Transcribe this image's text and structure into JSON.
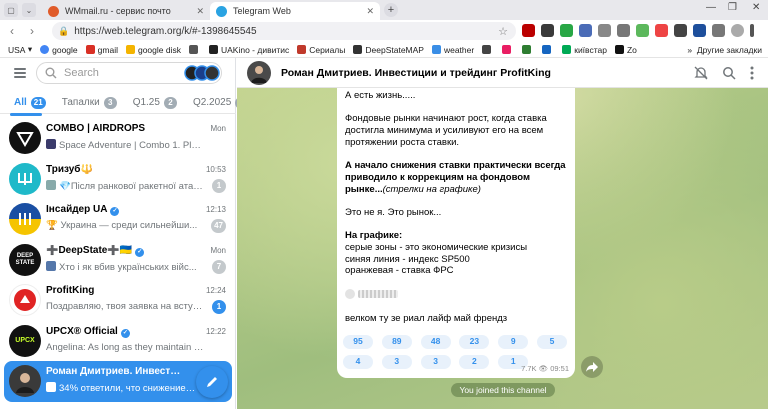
{
  "browser": {
    "tabs": [
      {
        "title": "WMmail.ru - сервис почто",
        "active": false
      },
      {
        "title": "Telegram Web",
        "active": true
      }
    ],
    "url": "https://web.telegram.org/k/#-1398645545",
    "bookmarks_left_label": "USA",
    "bookmarks": [
      "google",
      "gmail",
      "google disk",
      "",
      "UAKino - дивитис",
      "Сериалы",
      "DeepStateMAP",
      "weather",
      "",
      "",
      "",
      "",
      "київстар",
      "Zo"
    ],
    "other_bookmarks": "Другие закладки"
  },
  "sidebar": {
    "search_placeholder": "Search",
    "folders": [
      {
        "label": "All",
        "count": "21",
        "active": true
      },
      {
        "label": "Тапалки",
        "count": "3",
        "active": false
      },
      {
        "label": "Q1.25",
        "count": "2",
        "active": false
      },
      {
        "label": "Q2.2025",
        "count": "1",
        "active": false
      }
    ],
    "chats": [
      {
        "name": "COMBO | AIRDROPS",
        "time": "Mon",
        "preview": "Space Adventure | Combo 1. Pla...",
        "badge": "",
        "avatar_color": "#111111",
        "avatar_text": "",
        "verified": false
      },
      {
        "name": "Тризуб🔱",
        "time": "10:53",
        "preview": "💎Після ранкової ракетної атаки ...",
        "badge": "1",
        "avatar_color": "#1fb9c9",
        "avatar_text": "",
        "verified": false
      },
      {
        "name": "Інсайдер UA",
        "time": "12:13",
        "preview": "🏆 Украина — среди сильнейши...",
        "badge": "47",
        "avatar_color": "#1a4fa3",
        "avatar_text": "",
        "verified": true
      },
      {
        "name": "➕DeepState➕🇺🇦",
        "time": "Mon",
        "preview": "Хто і як вбив українських війс...",
        "badge": "7",
        "avatar_color": "#111111",
        "avatar_text": "DEEP STATE",
        "verified": true
      },
      {
        "name": "ProfitKing",
        "time": "12:24",
        "preview": "Поздравляю, твоя заявка на вступл...",
        "badge": "1",
        "avatar_color": "#ffffff",
        "avatar_text": "",
        "verified": false
      },
      {
        "name": "UPCX® Official",
        "time": "12:22",
        "preview": "Angelina: As long as they maintain liquidity,...",
        "badge": "",
        "avatar_color": "#111111",
        "avatar_text": "UPCX",
        "verified": true
      },
      {
        "name": "Роман Дмитриев. Инвестиции и ...",
        "time": "",
        "preview": "34% ответили, что снижение ста...",
        "badge": "",
        "avatar_color": "#3a3a3a",
        "avatar_text": "",
        "verified": false
      }
    ]
  },
  "chat": {
    "title": "Роман Дмитриев. Инвестиции и трейдинг ProfitKing",
    "message": {
      "p1": "А есть жизнь.....",
      "p2": "Фондовые рынки начинают рост, когда ставка достигла минимума и усиливуют его на всем протяжении роста ставки.",
      "p3_bold": "А начало снижения ставки практически всегда приводило к коррекциям на фондовом рынке...",
      "p3_italic": "(стрелки на графике)",
      "p4": "Это не я. Это рынок...",
      "p5_bold": "На графике:",
      "p5_l1": "серые зоны - это экономические кризисы",
      "p5_l2": "синяя линия - индекс SP500",
      "p5_l3": "оранжевая - ставка ФРС",
      "p6": "велком ту зе риал лайф май френдз"
    },
    "reactions_row1": [
      "95",
      "89",
      "48",
      "23",
      "9",
      "5"
    ],
    "reactions_row2": [
      "4",
      "3",
      "3",
      "2",
      "1",
      "1"
    ],
    "views": "7.7K",
    "time": "09:51",
    "joined_notice": "You joined this channel"
  }
}
